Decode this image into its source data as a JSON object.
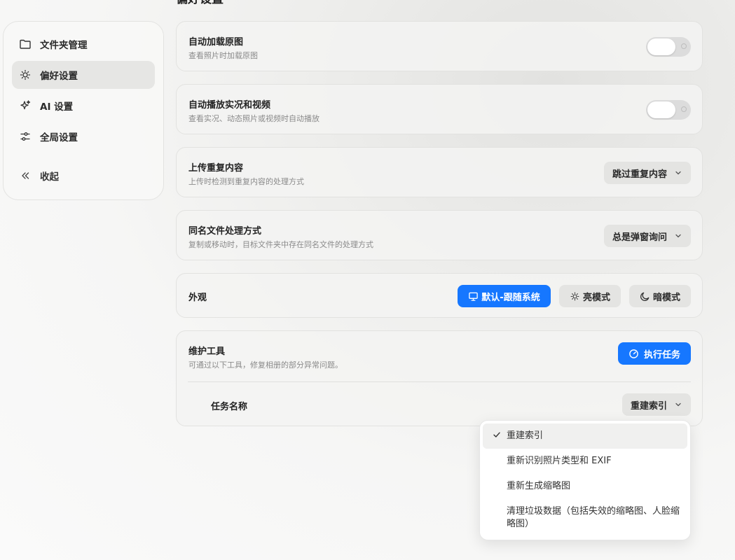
{
  "page": {
    "title": "偏好设置"
  },
  "sidebar": {
    "items": [
      {
        "label": "文件夹管理",
        "icon": "folder-icon"
      },
      {
        "label": "偏好设置",
        "icon": "sun-icon",
        "active": true
      },
      {
        "label": "AI 设置",
        "icon": "sparkle-icon"
      },
      {
        "label": "全局设置",
        "icon": "sliders-icon"
      }
    ],
    "collapse_label": "收起"
  },
  "settings": {
    "auto_load_original": {
      "title": "自动加载原图",
      "subtitle": "查看照片时加载原图",
      "enabled": false
    },
    "auto_play_live": {
      "title": "自动播放实况和视频",
      "subtitle": "查看实况、动态照片或视频时自动播放",
      "enabled": false
    },
    "upload_duplicate": {
      "title": "上传重复内容",
      "subtitle": "上传时检测到重复内容的处理方式",
      "value": "跳过重复内容"
    },
    "same_name": {
      "title": "同名文件处理方式",
      "subtitle": "复制或移动时，目标文件夹中存在同名文件的处理方式",
      "value": "总是弹窗询问"
    },
    "appearance": {
      "title": "外观",
      "options": [
        {
          "label": "默认-跟随系统",
          "icon": "monitor-icon",
          "active": true
        },
        {
          "label": "亮模式",
          "icon": "sun-icon"
        },
        {
          "label": "暗模式",
          "icon": "moon-icon"
        }
      ]
    },
    "maintenance": {
      "title": "维护工具",
      "subtitle": "可通过以下工具，修复相册的部分异常问题。",
      "run_label": "执行任务",
      "task_label": "任务名称",
      "task_value": "重建索引"
    }
  },
  "dropdown": {
    "options": [
      {
        "label": "重建索引",
        "selected": true
      },
      {
        "label": "重新识别照片类型和 EXIF"
      },
      {
        "label": "重新生成缩略图"
      },
      {
        "label": "清理垃圾数据（包括失效的缩略图、人脸缩略图）"
      }
    ]
  },
  "colors": {
    "accent": "#1677ff"
  }
}
